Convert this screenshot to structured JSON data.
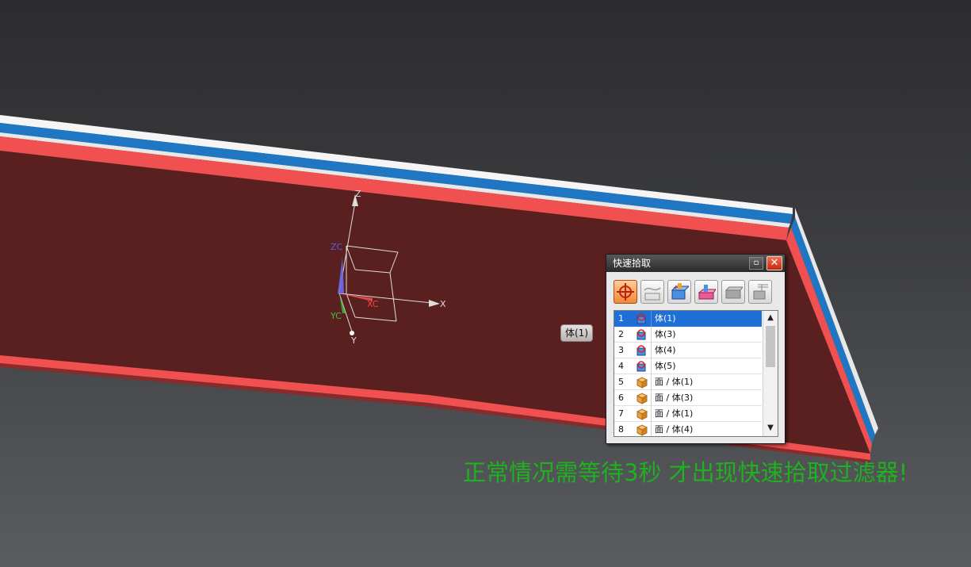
{
  "viewport": {
    "axes": {
      "x": "X",
      "y": "Y",
      "z": "Z",
      "xc": "XC",
      "yc": "YC",
      "zc": "ZC"
    },
    "colors": {
      "background_top": "#2c2c2e",
      "background_bottom": "#5a5c60",
      "part_face": "#5a2020",
      "red_stripe": "#f05050",
      "blue_stripe": "#1f77c4",
      "white_stripe": "#f5f5f5",
      "notice_text": "#1fb21f"
    }
  },
  "tooltip": {
    "text": "体(1)"
  },
  "quickpick": {
    "title": "快速拾取",
    "pin_icon": "pin-icon",
    "close_label": "✕",
    "toolbar": [
      {
        "name": "all-objects-filter",
        "icon": "crosshair-icon",
        "active": true
      },
      {
        "name": "curves-filter",
        "icon": "curve-icon",
        "active": false
      },
      {
        "name": "bodies-filter",
        "icon": "body-icon",
        "active": false
      },
      {
        "name": "features-filter",
        "icon": "feature-icon",
        "active": false
      },
      {
        "name": "faces-filter",
        "icon": "face-icon",
        "active": false
      },
      {
        "name": "other-filter",
        "icon": "component-icon",
        "active": false
      }
    ],
    "items": [
      {
        "num": "1",
        "label": "体(1)",
        "icon": "body-icon",
        "selected": true
      },
      {
        "num": "2",
        "label": "体(3)",
        "icon": "body-icon",
        "selected": false
      },
      {
        "num": "3",
        "label": "体(4)",
        "icon": "body-icon",
        "selected": false
      },
      {
        "num": "4",
        "label": "体(5)",
        "icon": "body-icon",
        "selected": false
      },
      {
        "num": "5",
        "label": "面 / 体(1)",
        "icon": "face-icon",
        "selected": false
      },
      {
        "num": "6",
        "label": "面 / 体(3)",
        "icon": "face-icon",
        "selected": false
      },
      {
        "num": "7",
        "label": "面 / 体(1)",
        "icon": "face-icon",
        "selected": false
      },
      {
        "num": "8",
        "label": "面 / 体(4)",
        "icon": "face-icon",
        "selected": false
      }
    ],
    "scroll_up": "▲",
    "scroll_down": "▼"
  },
  "notice": {
    "text": "正常情况需等待3秒 才出现快速拾取过滤器!"
  }
}
